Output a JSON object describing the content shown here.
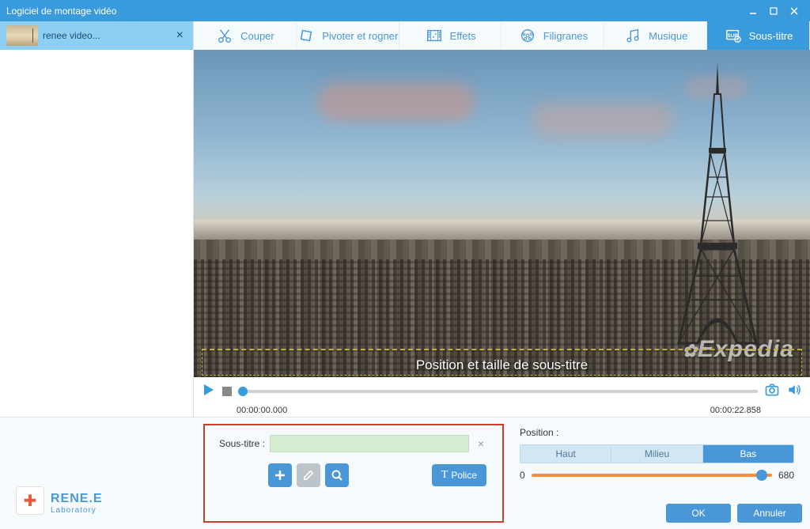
{
  "window": {
    "title": "Logiciel de montage vidéo"
  },
  "sidebar": {
    "file": {
      "name": "renee video..."
    }
  },
  "toolbar": {
    "cut": "Couper",
    "rotate": "Pivoter et rogner",
    "effects": "Effets",
    "watermark": "Filigranes",
    "music": "Musique",
    "subtitle": "Sous-titre"
  },
  "preview": {
    "watermark": "Expedia",
    "subtitle_overlay": "Position et taille de sous-titre"
  },
  "playback": {
    "start_time": "00:00:00.000",
    "end_time": "00:00:22.858"
  },
  "subtitle_panel": {
    "label": "Sous-titre :",
    "font_button": "Police"
  },
  "position_panel": {
    "label": "Position :",
    "top": "Haut",
    "middle": "Milieu",
    "bottom": "Bas",
    "min": "0",
    "max": "680"
  },
  "logo": {
    "main": "RENE.E",
    "sub": "Laboratory"
  },
  "dialog": {
    "ok": "OK",
    "cancel": "Annuler"
  }
}
